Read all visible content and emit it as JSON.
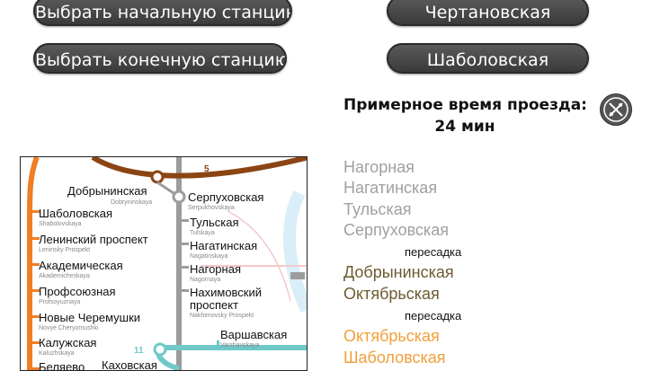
{
  "controls": {
    "start_button_label": "Выбрать начальную станцию",
    "end_button_label": "Выбрать конечную станцию",
    "start_station": "Чертановская",
    "end_station": "Шаболовская"
  },
  "travel": {
    "label": "Примерное время проезда:",
    "value": "24 мин"
  },
  "reset_icon": "clear-route-icon",
  "map": {
    "line_numbers": {
      "line5": "5",
      "line11": "11"
    },
    "stations": {
      "dobryninskaya": {
        "name": "Добрынинская",
        "sub": "Dobryninskaya"
      },
      "serpukhovskaya": {
        "name": "Серпуховская",
        "sub": "Serpukhovskaya"
      },
      "shabolovskaya": {
        "name": "Шаболовская",
        "sub": "Shabolovskaya"
      },
      "tulskaya": {
        "name": "Тульская",
        "sub": "Tulskaya"
      },
      "leninsky": {
        "name": "Ленинский проспект",
        "sub": "Leninsky Prospekt"
      },
      "nagatinskaya": {
        "name": "Нагатинская",
        "sub": "Nagatinskaya"
      },
      "akademicheskaya": {
        "name": "Академическая",
        "sub": "Akademicheskaya"
      },
      "nagornaya": {
        "name": "Нагорная",
        "sub": "Nagornaya"
      },
      "profsoyuznaya": {
        "name": "Профсоюзная",
        "sub": "Profsoyuznaya"
      },
      "nakhimovsky_1": "Нахимовский",
      "nakhimovsky_2": "проспект",
      "nakhimovsky_sub": "Nakhimovsky Prospekt",
      "novye_cheryomushki": {
        "name": "Новые Черемушки",
        "sub": "Novye Cheryomushki"
      },
      "varshavskaya": {
        "name": "Варшавская",
        "sub": "Varshavskaya"
      },
      "kaluzhskaya": {
        "name": "Калужская",
        "sub": "Kaluzhskaya"
      },
      "kakhovskaya": "Каховская",
      "belyaevo": "Беляево"
    },
    "colors": {
      "line5": "#8b4513",
      "line6": "#f07e25",
      "line9": "#9c9c9c",
      "line11": "#6fc9c9"
    }
  },
  "route": [
    {
      "text": "Нагорная",
      "kind": "gray"
    },
    {
      "text": "Нагатинская",
      "kind": "gray"
    },
    {
      "text": "Тульская",
      "kind": "gray"
    },
    {
      "text": "Серпуховская",
      "kind": "gray"
    },
    {
      "text": "пересадка",
      "kind": "transfer"
    },
    {
      "text": "Добрынинская",
      "kind": "brown"
    },
    {
      "text": "Октябрьская",
      "kind": "brown"
    },
    {
      "text": "пересадка",
      "kind": "transfer"
    },
    {
      "text": "Октябрьская",
      "kind": "orange"
    },
    {
      "text": "Шаболовская",
      "kind": "orange"
    }
  ]
}
